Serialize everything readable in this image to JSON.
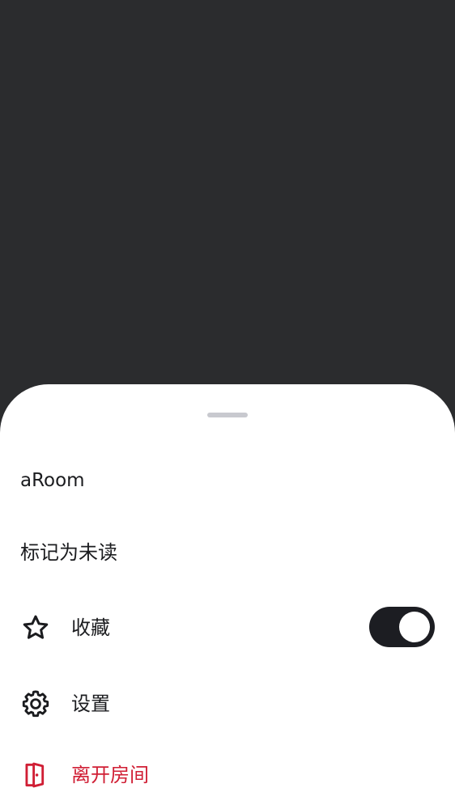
{
  "sheet": {
    "room_name": "aRoom",
    "mark_unread_label": "标记为未读",
    "favourite": {
      "label": "收藏",
      "icon": "star-icon",
      "toggle_on": true
    },
    "settings": {
      "label": "设置",
      "icon": "gear-icon"
    },
    "leave": {
      "label": "离开房间",
      "icon": "door-exit-icon",
      "color": "#d01e34"
    }
  },
  "colors": {
    "backdrop": "#2b2c2e",
    "sheet": "#ffffff",
    "text": "#1b1c1f",
    "toggle_track": "#1c1d22",
    "destructive": "#d01e34"
  }
}
